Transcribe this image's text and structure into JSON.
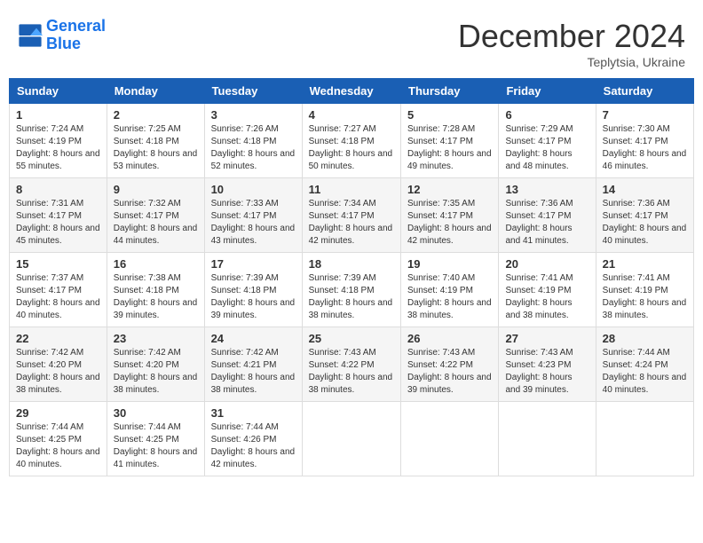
{
  "header": {
    "logo_line1": "General",
    "logo_line2": "Blue",
    "month_year": "December 2024",
    "location": "Teplytsia, Ukraine"
  },
  "weekdays": [
    "Sunday",
    "Monday",
    "Tuesday",
    "Wednesday",
    "Thursday",
    "Friday",
    "Saturday"
  ],
  "weeks": [
    [
      {
        "day": "1",
        "sunrise": "Sunrise: 7:24 AM",
        "sunset": "Sunset: 4:19 PM",
        "daylight": "Daylight: 8 hours and 55 minutes."
      },
      {
        "day": "2",
        "sunrise": "Sunrise: 7:25 AM",
        "sunset": "Sunset: 4:18 PM",
        "daylight": "Daylight: 8 hours and 53 minutes."
      },
      {
        "day": "3",
        "sunrise": "Sunrise: 7:26 AM",
        "sunset": "Sunset: 4:18 PM",
        "daylight": "Daylight: 8 hours and 52 minutes."
      },
      {
        "day": "4",
        "sunrise": "Sunrise: 7:27 AM",
        "sunset": "Sunset: 4:18 PM",
        "daylight": "Daylight: 8 hours and 50 minutes."
      },
      {
        "day": "5",
        "sunrise": "Sunrise: 7:28 AM",
        "sunset": "Sunset: 4:17 PM",
        "daylight": "Daylight: 8 hours and 49 minutes."
      },
      {
        "day": "6",
        "sunrise": "Sunrise: 7:29 AM",
        "sunset": "Sunset: 4:17 PM",
        "daylight": "Daylight: 8 hours and 48 minutes."
      },
      {
        "day": "7",
        "sunrise": "Sunrise: 7:30 AM",
        "sunset": "Sunset: 4:17 PM",
        "daylight": "Daylight: 8 hours and 46 minutes."
      }
    ],
    [
      {
        "day": "8",
        "sunrise": "Sunrise: 7:31 AM",
        "sunset": "Sunset: 4:17 PM",
        "daylight": "Daylight: 8 hours and 45 minutes."
      },
      {
        "day": "9",
        "sunrise": "Sunrise: 7:32 AM",
        "sunset": "Sunset: 4:17 PM",
        "daylight": "Daylight: 8 hours and 44 minutes."
      },
      {
        "day": "10",
        "sunrise": "Sunrise: 7:33 AM",
        "sunset": "Sunset: 4:17 PM",
        "daylight": "Daylight: 8 hours and 43 minutes."
      },
      {
        "day": "11",
        "sunrise": "Sunrise: 7:34 AM",
        "sunset": "Sunset: 4:17 PM",
        "daylight": "Daylight: 8 hours and 42 minutes."
      },
      {
        "day": "12",
        "sunrise": "Sunrise: 7:35 AM",
        "sunset": "Sunset: 4:17 PM",
        "daylight": "Daylight: 8 hours and 42 minutes."
      },
      {
        "day": "13",
        "sunrise": "Sunrise: 7:36 AM",
        "sunset": "Sunset: 4:17 PM",
        "daylight": "Daylight: 8 hours and 41 minutes."
      },
      {
        "day": "14",
        "sunrise": "Sunrise: 7:36 AM",
        "sunset": "Sunset: 4:17 PM",
        "daylight": "Daylight: 8 hours and 40 minutes."
      }
    ],
    [
      {
        "day": "15",
        "sunrise": "Sunrise: 7:37 AM",
        "sunset": "Sunset: 4:17 PM",
        "daylight": "Daylight: 8 hours and 40 minutes."
      },
      {
        "day": "16",
        "sunrise": "Sunrise: 7:38 AM",
        "sunset": "Sunset: 4:18 PM",
        "daylight": "Daylight: 8 hours and 39 minutes."
      },
      {
        "day": "17",
        "sunrise": "Sunrise: 7:39 AM",
        "sunset": "Sunset: 4:18 PM",
        "daylight": "Daylight: 8 hours and 39 minutes."
      },
      {
        "day": "18",
        "sunrise": "Sunrise: 7:39 AM",
        "sunset": "Sunset: 4:18 PM",
        "daylight": "Daylight: 8 hours and 38 minutes."
      },
      {
        "day": "19",
        "sunrise": "Sunrise: 7:40 AM",
        "sunset": "Sunset: 4:19 PM",
        "daylight": "Daylight: 8 hours and 38 minutes."
      },
      {
        "day": "20",
        "sunrise": "Sunrise: 7:41 AM",
        "sunset": "Sunset: 4:19 PM",
        "daylight": "Daylight: 8 hours and 38 minutes."
      },
      {
        "day": "21",
        "sunrise": "Sunrise: 7:41 AM",
        "sunset": "Sunset: 4:19 PM",
        "daylight": "Daylight: 8 hours and 38 minutes."
      }
    ],
    [
      {
        "day": "22",
        "sunrise": "Sunrise: 7:42 AM",
        "sunset": "Sunset: 4:20 PM",
        "daylight": "Daylight: 8 hours and 38 minutes."
      },
      {
        "day": "23",
        "sunrise": "Sunrise: 7:42 AM",
        "sunset": "Sunset: 4:20 PM",
        "daylight": "Daylight: 8 hours and 38 minutes."
      },
      {
        "day": "24",
        "sunrise": "Sunrise: 7:42 AM",
        "sunset": "Sunset: 4:21 PM",
        "daylight": "Daylight: 8 hours and 38 minutes."
      },
      {
        "day": "25",
        "sunrise": "Sunrise: 7:43 AM",
        "sunset": "Sunset: 4:22 PM",
        "daylight": "Daylight: 8 hours and 38 minutes."
      },
      {
        "day": "26",
        "sunrise": "Sunrise: 7:43 AM",
        "sunset": "Sunset: 4:22 PM",
        "daylight": "Daylight: 8 hours and 39 minutes."
      },
      {
        "day": "27",
        "sunrise": "Sunrise: 7:43 AM",
        "sunset": "Sunset: 4:23 PM",
        "daylight": "Daylight: 8 hours and 39 minutes."
      },
      {
        "day": "28",
        "sunrise": "Sunrise: 7:44 AM",
        "sunset": "Sunset: 4:24 PM",
        "daylight": "Daylight: 8 hours and 40 minutes."
      }
    ],
    [
      {
        "day": "29",
        "sunrise": "Sunrise: 7:44 AM",
        "sunset": "Sunset: 4:25 PM",
        "daylight": "Daylight: 8 hours and 40 minutes."
      },
      {
        "day": "30",
        "sunrise": "Sunrise: 7:44 AM",
        "sunset": "Sunset: 4:25 PM",
        "daylight": "Daylight: 8 hours and 41 minutes."
      },
      {
        "day": "31",
        "sunrise": "Sunrise: 7:44 AM",
        "sunset": "Sunset: 4:26 PM",
        "daylight": "Daylight: 8 hours and 42 minutes."
      },
      null,
      null,
      null,
      null
    ]
  ]
}
